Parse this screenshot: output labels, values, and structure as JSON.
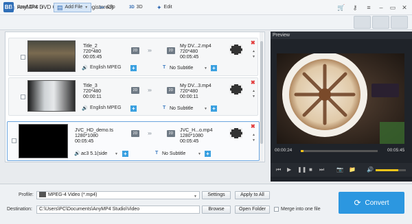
{
  "app": {
    "title": "AnyMP4 DVD Converter (Unregistered)",
    "logo_text": "BB"
  },
  "toolbar": {
    "load_disc": "Load Disc",
    "add_file": "Add File",
    "clip": "Clip",
    "threed": "3D",
    "edit": "Edit",
    "right_buttons": [
      "merge",
      "rename",
      "remove"
    ]
  },
  "items": [
    {
      "title": "Title_2",
      "resolution": "720*480",
      "duration": "00:05:45",
      "out_name": "My DV...2.mp4",
      "out_resolution": "720*480",
      "out_duration": "00:05:45",
      "audio": "English MPEG",
      "subtitle": "No Subtitle"
    },
    {
      "title": "Title_3",
      "resolution": "720*480",
      "duration": "00:00:11",
      "out_name": "My DV...3.mp4",
      "out_resolution": "720*480",
      "out_duration": "00:00:11",
      "audio": "English MPEG",
      "subtitle": "No Subtitle"
    },
    {
      "title": "JVC_HD_demo.ts",
      "resolution": "1280*1080",
      "duration": "00:05:45",
      "out_name": "JVC_H...o.mp4",
      "out_resolution": "1280*1080",
      "out_duration": "00:05:45",
      "audio": "ac3 5.1(side",
      "subtitle": "No Subtitle"
    }
  ],
  "badge_2d": "2D",
  "preview": {
    "header": "Preview",
    "time_current": "00:00:24",
    "time_total": "00:05:45",
    "progress": 0.04,
    "volume": 0.75
  },
  "bottom": {
    "profile_label": "Profile:",
    "profile_value": "MPEG-4 Video (*.mp4)",
    "settings": "Settings",
    "apply_all": "Apply to All",
    "destination_label": "Destination:",
    "destination_value": "C:\\Users\\PC\\Documents\\AnyMP4 Studio\\Video",
    "browse": "Browse",
    "open_folder": "Open Folder",
    "merge_label": "Merge into one file",
    "convert": "Convert"
  },
  "colors": {
    "accent": "#2c97e0",
    "progress": "#f0c419",
    "remove": "#e23b3b"
  }
}
